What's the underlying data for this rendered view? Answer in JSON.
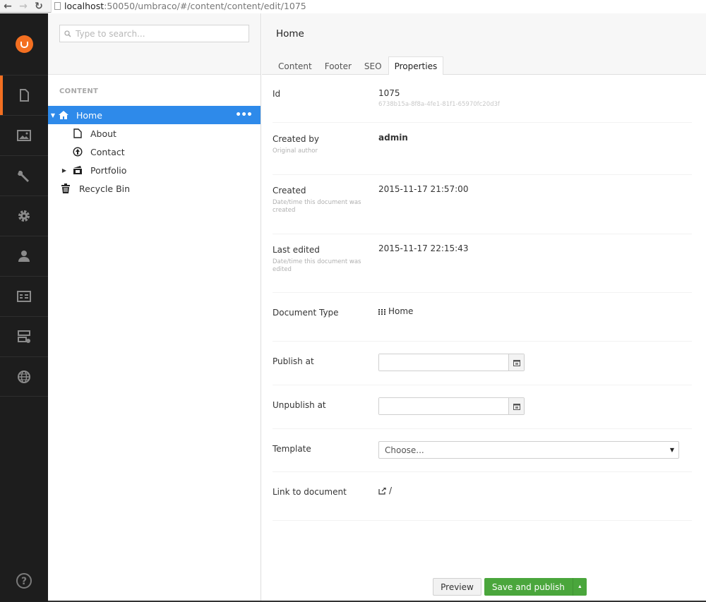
{
  "browser": {
    "url_host": "localhost",
    "url_rest": ":50050/umbraco/#/content/content/edit/1075"
  },
  "sections": [
    {
      "name": "content",
      "icon": "document-icon",
      "active": true
    },
    {
      "name": "media",
      "icon": "image-icon",
      "active": false
    },
    {
      "name": "developer",
      "icon": "wrench-icon",
      "active": false
    },
    {
      "name": "settings",
      "icon": "gear-icon",
      "active": false
    },
    {
      "name": "users",
      "icon": "user-icon",
      "active": false
    },
    {
      "name": "members",
      "icon": "id-card-icon",
      "active": false
    },
    {
      "name": "forms",
      "icon": "form-settings-icon",
      "active": false
    },
    {
      "name": "translation",
      "icon": "globe-icon",
      "active": false
    }
  ],
  "tree": {
    "search_placeholder": "Type to search...",
    "title": "CONTENT",
    "items": [
      {
        "label": "Home",
        "icon": "home-icon",
        "selected": true,
        "expanded": true
      },
      {
        "label": "About",
        "icon": "document-icon"
      },
      {
        "label": "Contact",
        "icon": "contact-icon"
      },
      {
        "label": "Portfolio",
        "icon": "portfolio-icon",
        "collapsed": true
      },
      {
        "label": "Recycle Bin",
        "icon": "trash-icon"
      }
    ],
    "more_label": "•••"
  },
  "editor": {
    "title": "Home",
    "tabs": [
      {
        "label": "Content",
        "active": false
      },
      {
        "label": "Footer",
        "active": false
      },
      {
        "label": "SEO",
        "active": false
      },
      {
        "label": "Properties",
        "active": true
      }
    ],
    "properties": {
      "id": {
        "label": "Id",
        "value": "1075",
        "guid": "6738b15a-8f8a-4fe1-81f1-65970fc20d3f"
      },
      "created_by": {
        "label": "Created by",
        "description": "Original author",
        "value": "admin"
      },
      "created": {
        "label": "Created",
        "description": "Date/time this document was created",
        "value": "2015-11-17 21:57:00"
      },
      "last_edited": {
        "label": "Last edited",
        "description": "Date/time this document was edited",
        "value": "2015-11-17 22:15:43"
      },
      "doc_type": {
        "label": "Document Type",
        "value": "Home"
      },
      "publish_at": {
        "label": "Publish at",
        "value": ""
      },
      "unpublish_at": {
        "label": "Unpublish at",
        "value": ""
      },
      "template": {
        "label": "Template",
        "value": "Choose..."
      },
      "link": {
        "label": "Link to document",
        "value": "/"
      }
    },
    "buttons": {
      "preview": "Preview",
      "save_publish": "Save and publish"
    }
  },
  "colors": {
    "brand_orange": "#f36f21",
    "selection_blue": "#2e8aea",
    "publish_green": "#4aa63c",
    "sidebar_dark": "#1d1d1d"
  }
}
